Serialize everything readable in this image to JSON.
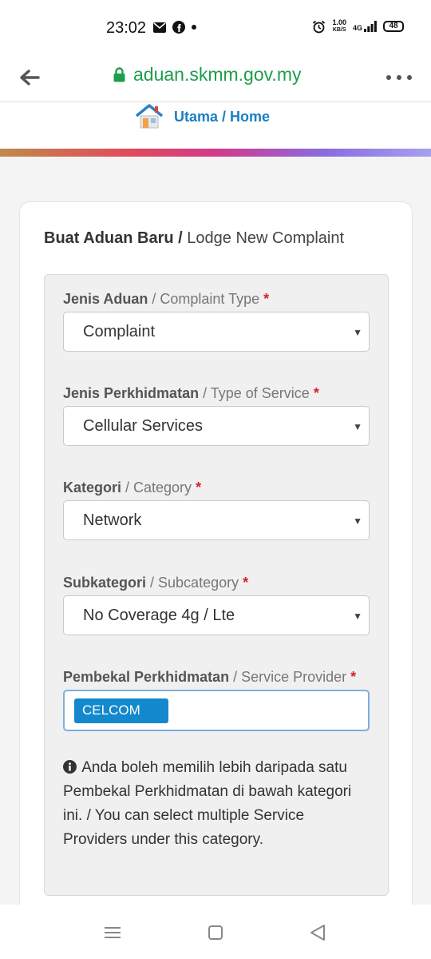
{
  "status": {
    "time": "23:02",
    "netspeed_value": "1.00",
    "netspeed_unit": "KB/S",
    "network": "4G",
    "battery": "48"
  },
  "browser": {
    "url": "aduan.skmm.gov.my"
  },
  "home": {
    "label": "Utama / Home"
  },
  "card": {
    "title_ms": "Buat Aduan Baru /",
    "title_en": " Lodge New Complaint"
  },
  "form": {
    "complaint_type": {
      "label_ms": "Jenis Aduan",
      "label_en": " / Complaint Type",
      "required": " *",
      "value": "Complaint"
    },
    "service_type": {
      "label_ms": "Jenis Perkhidmatan",
      "label_en": " / Type of Service",
      "required": " *",
      "value": "Cellular Services"
    },
    "category": {
      "label_ms": "Kategori",
      "label_en": " / Category",
      "required": " *",
      "value": "Network"
    },
    "subcategory": {
      "label_ms": "Subkategori",
      "label_en": " / Subcategory",
      "required": " *",
      "value": "No Coverage 4g / Lte"
    },
    "provider": {
      "label_ms": "Pembekal Perkhidmatan",
      "label_en": " / Service Provider",
      "required": " *",
      "selected": "CELCOM"
    },
    "note": "Anda boleh memilih lebih daripada satu Pembekal Perkhidmatan di bawah kategori ini. / You can select multiple Service Providers under this category."
  },
  "colors": {
    "url_green": "#1e9e4a",
    "link_blue": "#1a7fc4",
    "chip_blue": "#1488cc",
    "required_red": "#d3232a"
  }
}
